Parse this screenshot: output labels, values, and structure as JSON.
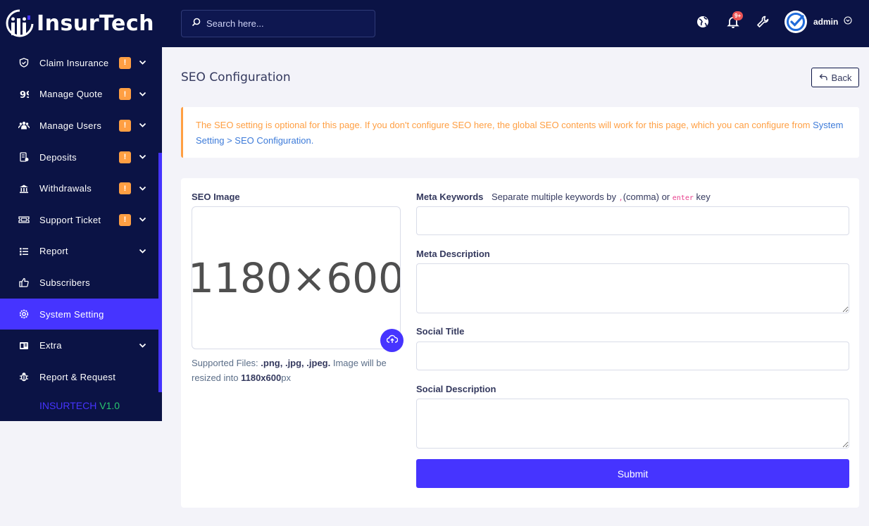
{
  "brand": {
    "name": "InsurTech",
    "version_name": "INSURTECH",
    "version_number": "V1.0",
    "accent_color": "#4634ff",
    "sidebar_color": "#0b1345",
    "warning_color": "#ff9f43"
  },
  "sidebar": {
    "items": [
      {
        "label": "Claim Insurance",
        "icon": "shield-icon",
        "badge": "!",
        "has_dropdown": true
      },
      {
        "label": "Manage Quote",
        "icon": "quote-icon",
        "badge": "!",
        "has_dropdown": true
      },
      {
        "label": "Manage Users",
        "icon": "users-icon",
        "badge": "!",
        "has_dropdown": true
      },
      {
        "label": "Deposits",
        "icon": "deposit-icon",
        "badge": "!",
        "has_dropdown": true
      },
      {
        "label": "Withdrawals",
        "icon": "bank-icon",
        "badge": "!",
        "has_dropdown": true
      },
      {
        "label": "Support Ticket",
        "icon": "ticket-icon",
        "badge": "!",
        "has_dropdown": true
      },
      {
        "label": "Report",
        "icon": "list-icon",
        "badge": "",
        "has_dropdown": true
      },
      {
        "label": "Subscribers",
        "icon": "thumbs-up-icon",
        "badge": "",
        "has_dropdown": false
      },
      {
        "label": "System Setting",
        "icon": "gear-icon",
        "badge": "",
        "has_dropdown": false,
        "active": true
      },
      {
        "label": "Extra",
        "icon": "extra-icon",
        "badge": "",
        "has_dropdown": true
      },
      {
        "label": "Report & Request",
        "icon": "bug-icon",
        "badge": "",
        "has_dropdown": false
      }
    ]
  },
  "topbar": {
    "search_placeholder": "Search here...",
    "notification_count": "9+",
    "username": "admin"
  },
  "page": {
    "title": "SEO Configuration",
    "back_label": "Back",
    "alert_text": "The SEO setting is optional for this page. If you don't configure SEO here, the global SEO contents will work for this page, which you can configure from",
    "alert_link": "System Setting > SEO Configuration",
    "alert_end": "."
  },
  "form": {
    "seo_image_label": "SEO Image",
    "image_placeholder": "1180×600",
    "support_prefix": "Supported Files:",
    "support_types": ".png, .jpg, .jpeg.",
    "support_mid": "Image will be resized into",
    "support_size": "1180x600",
    "support_unit": "px",
    "meta_keywords_label": "Meta Keywords",
    "meta_keywords_hint_1": "Separate multiple keywords by",
    "meta_keywords_hint_code_1": ",",
    "meta_keywords_hint_2": "(comma) or",
    "meta_keywords_hint_code_2": "enter",
    "meta_keywords_hint_3": "key",
    "meta_description_label": "Meta Description",
    "social_title_label": "Social Title",
    "social_description_label": "Social Description",
    "submit_label": "Submit"
  }
}
